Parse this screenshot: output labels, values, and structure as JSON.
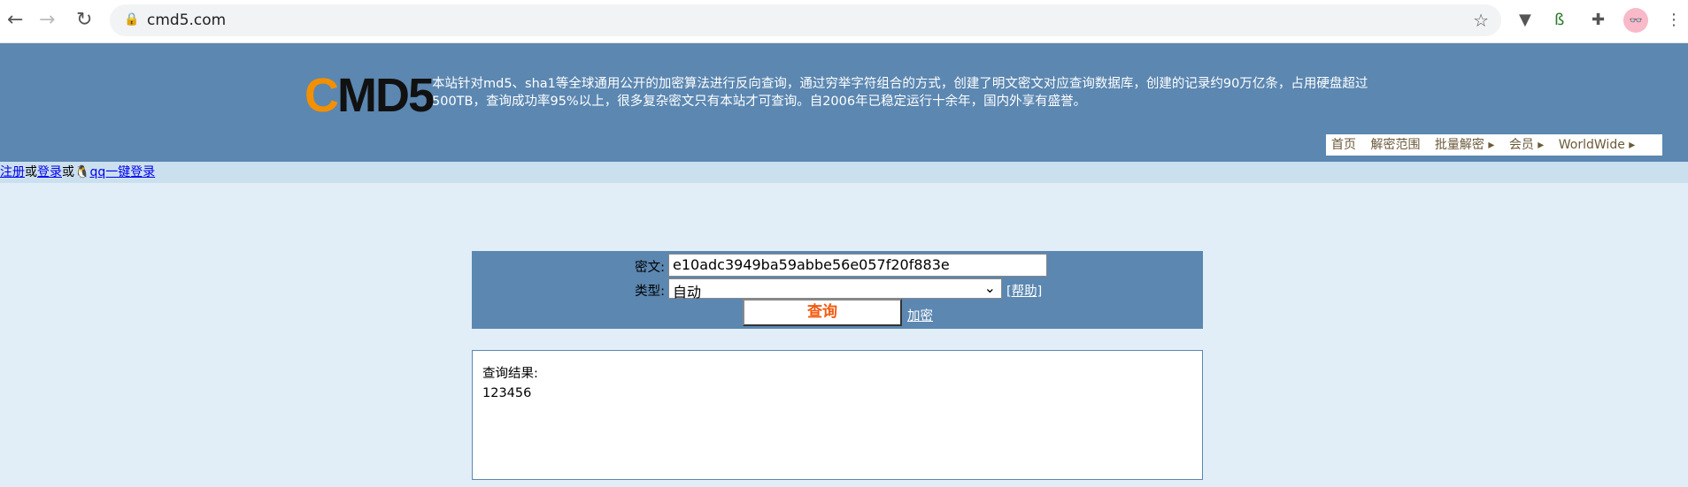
{
  "browser": {
    "url": "cmd5.com"
  },
  "header": {
    "logo_c": "C",
    "logo_rest": "MD5",
    "description": "本站针对md5、sha1等全球通用公开的加密算法进行反向查询，通过穷举字符组合的方式，创建了明文密文对应查询数据库，创建的记录约90万亿条，占用硬盘超过500TB，查询成功率95%以上，很多复杂密文只有本站才可查询。自2006年已稳定运行十余年，国内外享有盛誉。",
    "menu": [
      "首页",
      "解密范围",
      "批量解密 ▸",
      "会员 ▸",
      "WorldWide ▸"
    ]
  },
  "login": {
    "register": "注册",
    "or1": "或",
    "login": "登录",
    "or2": "或",
    "qq_login": "qq一键登录"
  },
  "form": {
    "cipher_label": "密文:",
    "cipher_value": "e10adc3949ba59abbe56e057f20f883e",
    "type_label": "类型:",
    "type_value": "自动",
    "help": "[帮助]",
    "query_button": "查询",
    "encrypt_link": "加密"
  },
  "result": {
    "title": "查询结果:",
    "value": "123456"
  }
}
